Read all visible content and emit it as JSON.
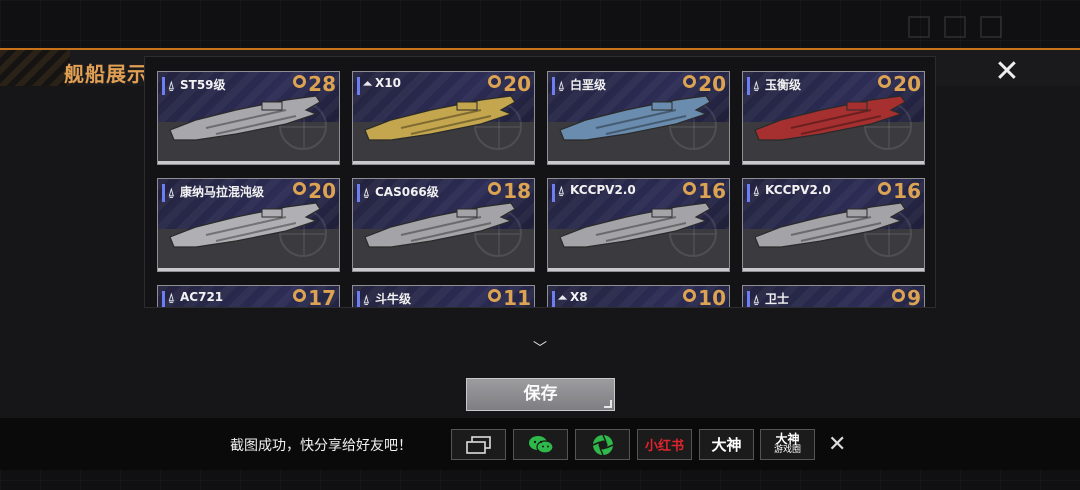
{
  "header": {
    "title": "舰船展示",
    "close_icon": "close-icon"
  },
  "ships": [
    {
      "name": "ST59级",
      "level": "28",
      "cls": "destroyer",
      "color": "#a8a8ac"
    },
    {
      "name": "X10",
      "level": "20",
      "cls": "frigate",
      "color": "#c4a64e"
    },
    {
      "name": "白垩级",
      "level": "20",
      "cls": "destroyer",
      "color": "#6a8cae"
    },
    {
      "name": "玉衡级",
      "level": "20",
      "cls": "destroyer",
      "color": "#a63030"
    },
    {
      "name": "康纳马拉混沌级",
      "level": "20",
      "cls": "destroyer",
      "color": "#b0b0b4"
    },
    {
      "name": "CAS066级",
      "level": "18",
      "cls": "destroyer",
      "color": "#a4a4a8"
    },
    {
      "name": "KCCPV2.0",
      "level": "16",
      "cls": "destroyer",
      "color": "#a4a4a8"
    },
    {
      "name": "KCCPV2.0",
      "level": "16",
      "cls": "destroyer",
      "color": "#a4a4a8"
    },
    {
      "name": "AC721",
      "level": "17",
      "cls": "destroyer",
      "color": "#a4a4a8"
    },
    {
      "name": "斗牛级",
      "level": "11",
      "cls": "destroyer",
      "color": "#a4a4a8"
    },
    {
      "name": "X8",
      "level": "10",
      "cls": "frigate",
      "color": "#a4a4a8"
    },
    {
      "name": "卫士",
      "level": "9",
      "cls": "destroyer",
      "color": "#a4a4a8"
    }
  ],
  "save_label": "保存",
  "share": {
    "message": "截图成功，快分享给好友吧！",
    "xiaohongshu": "小红书",
    "dashen": "大神",
    "dashen_app_top": "大神",
    "dashen_app_bottom": "游戏圈"
  },
  "colors": {
    "accent_orange": "#c8731a",
    "level_gold": "#dca352",
    "title_orange": "#e2a055"
  }
}
